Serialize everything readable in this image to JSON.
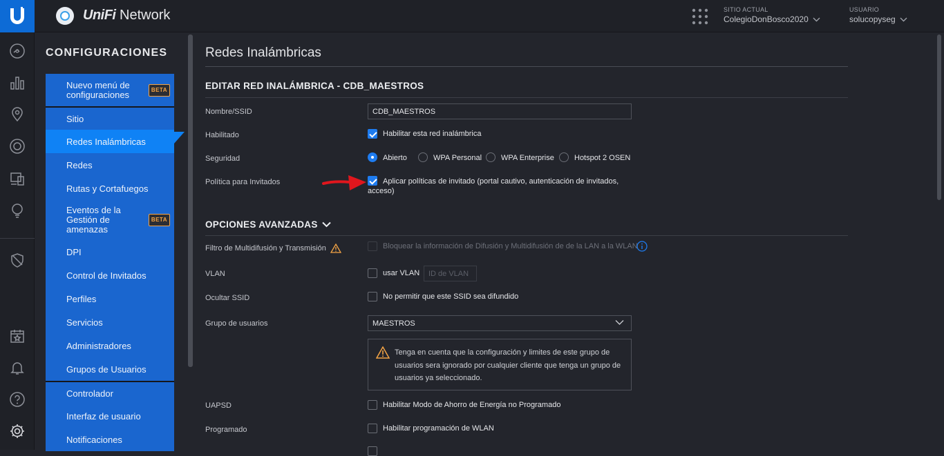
{
  "header": {
    "app_name_brand": "UniFi",
    "app_name_rest": " Network",
    "site_label": "SITIO ACTUAL",
    "site_value": "ColegioDonBosco2020",
    "user_label": "USUARIO",
    "user_value": "solucopyseg"
  },
  "menu": {
    "title": "CONFIGURACIONES",
    "items": [
      {
        "label": "Nuevo menú de configuraciones",
        "badge": "BETA"
      },
      {
        "label": "Sitio"
      },
      {
        "label": "Redes Inalámbricas"
      },
      {
        "label": "Redes"
      },
      {
        "label": "Rutas y Cortafuegos"
      },
      {
        "label": "Eventos de la Gestión de amenazas",
        "badge": "BETA"
      },
      {
        "label": "DPI"
      },
      {
        "label": "Control de Invitados"
      },
      {
        "label": "Perfiles"
      },
      {
        "label": "Servicios"
      },
      {
        "label": "Administradores"
      },
      {
        "label": "Grupos de Usuarios"
      },
      {
        "label": "Controlador"
      },
      {
        "label": "Interfaz de usuario"
      },
      {
        "label": "Notificaciones"
      }
    ]
  },
  "page": {
    "title": "Redes Inalámbricas",
    "edit_section": "EDITAR RED INALÁMBRICA - CDB_MAESTROS",
    "ssid_label": "Nombre/SSID",
    "ssid_value": "CDB_MAESTROS",
    "enabled_label": "Habilitado",
    "enabled_text": "Habilitar esta red inalámbrica",
    "security_label": "Seguridad",
    "security_options": [
      "Abierto",
      "WPA Personal",
      "WPA Enterprise",
      "Hotspot 2 OSEN"
    ],
    "security_selected": "Abierto",
    "guest_label": "Política para Invitados",
    "guest_text_1": "Aplicar políticas de invitado (portal cautivo, autenticación de invitados,",
    "guest_text_2": "acceso)",
    "advanced_section": "OPCIONES AVANZADAS",
    "multicast_label": "Filtro de Multidifusión y Transmisión",
    "multicast_text": "Bloquear la información de Difusión y Multidifusión de de la LAN a la WLAN",
    "vlan_label": "VLAN",
    "vlan_text": "usar VLAN",
    "vlan_placeholder": "ID de VLAN",
    "hide_ssid_label": "Ocultar SSID",
    "hide_ssid_text": "No permitir que este SSID sea difundido",
    "user_group_label": "Grupo de usuarios",
    "user_group_value": "MAESTROS",
    "user_group_warning": "Tenga en cuenta que la configuración y limites de este grupo de usuarios sera ignorado por cualquier cliente que tenga un grupo de usuarios ya seleccionado.",
    "uapsd_label": "UAPSD",
    "uapsd_text": "Habilitar Modo de Ahorro de Energía no Programado",
    "scheduled_label": "Programado",
    "scheduled_text": "Habilitar programación de WLAN"
  },
  "colors": {
    "accent": "#0f82f5",
    "menu_bg": "#1a66cf",
    "warning": "#f4a445",
    "annotation": "#e0161d"
  }
}
